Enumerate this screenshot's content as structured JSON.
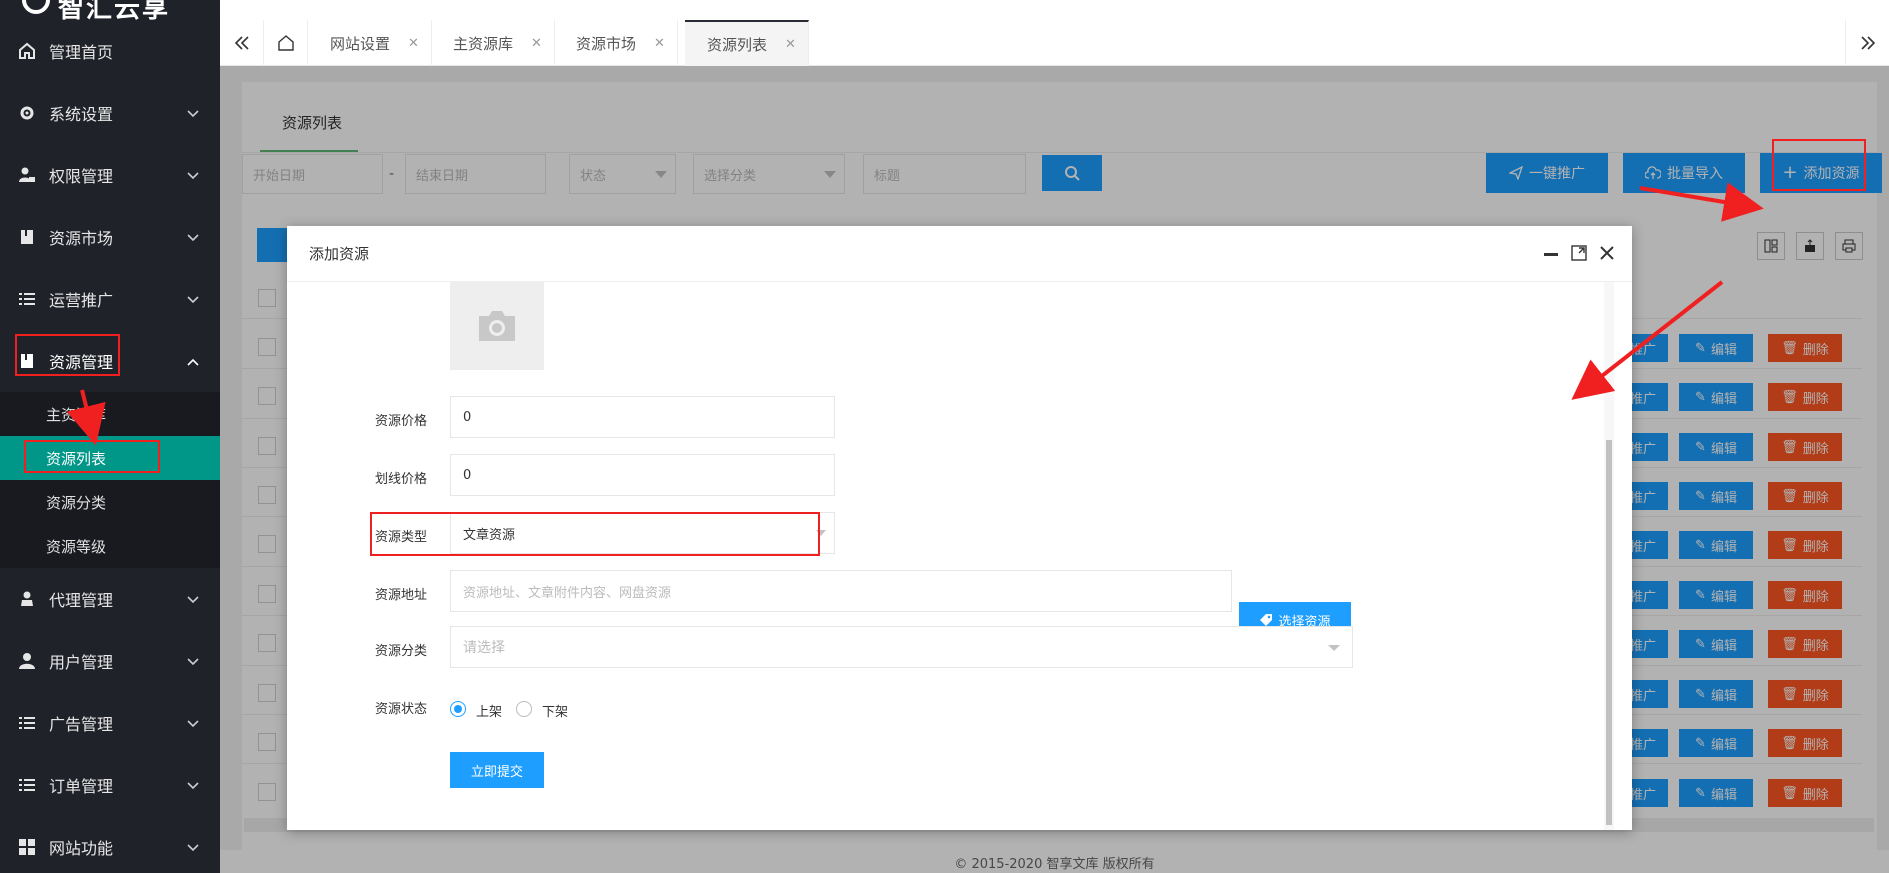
{
  "brand": {
    "logo_text": "智汇云享"
  },
  "sidebar": {
    "items": [
      {
        "label": "管理首页",
        "icon": "home-icon"
      },
      {
        "label": "系统设置",
        "icon": "gear-icon"
      },
      {
        "label": "权限管理",
        "icon": "user-lock-icon"
      },
      {
        "label": "资源市场",
        "icon": "book-icon"
      },
      {
        "label": "运营推广",
        "icon": "list-icon"
      },
      {
        "label": "资源管理",
        "icon": "book-icon"
      },
      {
        "label": "代理管理",
        "icon": "agent-icon"
      },
      {
        "label": "用户管理",
        "icon": "user-icon"
      },
      {
        "label": "广告管理",
        "icon": "list-icon"
      },
      {
        "label": "订单管理",
        "icon": "list-icon"
      },
      {
        "label": "网站功能",
        "icon": "grid-icon"
      }
    ],
    "sub_items": [
      "主资源库",
      "资源列表",
      "资源分类",
      "资源等级"
    ],
    "active_sub": "资源列表"
  },
  "tabs": [
    {
      "label": "网站设置"
    },
    {
      "label": "主资源库"
    },
    {
      "label": "资源市场"
    },
    {
      "label": "资源列表"
    }
  ],
  "page": {
    "title": "资源列表",
    "filters": {
      "start_date": "开始日期",
      "end_date": "结束日期",
      "dash": "-",
      "status": "状态",
      "category": "选择分类",
      "title": "标题"
    },
    "actions": {
      "promote": "一键推广",
      "import": "批量导入",
      "add": "添加资源"
    },
    "row_buttons": {
      "promote": "推广",
      "edit": "编辑",
      "delete": "删除"
    }
  },
  "modal": {
    "title": "添加资源",
    "fields": {
      "price_label": "资源价格",
      "price_value": "0",
      "strike_label": "划线价格",
      "strike_value": "0",
      "type_label": "资源类型",
      "type_value": "文章资源",
      "address_label": "资源地址",
      "address_placeholder": "资源地址、文章附件内容、网盘资源",
      "select_btn": "选择资源",
      "category_label": "资源分类",
      "category_placeholder": "请选择",
      "status_label": "资源状态",
      "status_on": "上架",
      "status_off": "下架"
    },
    "submit": "立即提交"
  },
  "footer": "© 2015-2020 智享文库 版权所有",
  "colors": {
    "sidebar": "#20222a",
    "active": "#009688",
    "primary": "#1e9fff",
    "danger": "#ff5722",
    "annotation": "#f02020"
  }
}
